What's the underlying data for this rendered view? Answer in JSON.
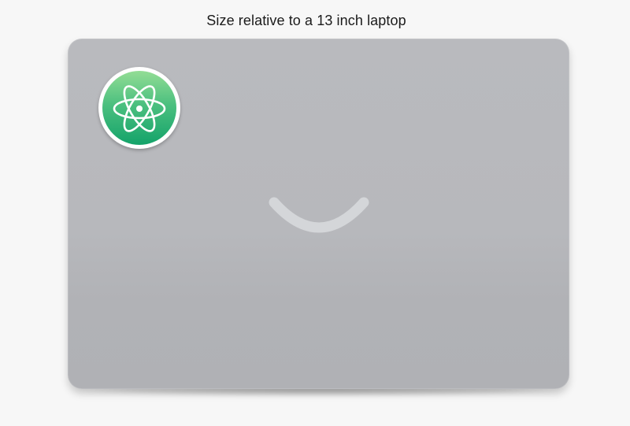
{
  "caption": "Size relative to a 13 inch laptop",
  "laptop": {
    "lid_color": "#b8b9bd",
    "logo_color": "#d4d6d9"
  },
  "sticker": {
    "icon": "atom-icon",
    "border_color": "#ffffff",
    "gradient_top": "#93dd95",
    "gradient_bottom": "#14a36a"
  }
}
